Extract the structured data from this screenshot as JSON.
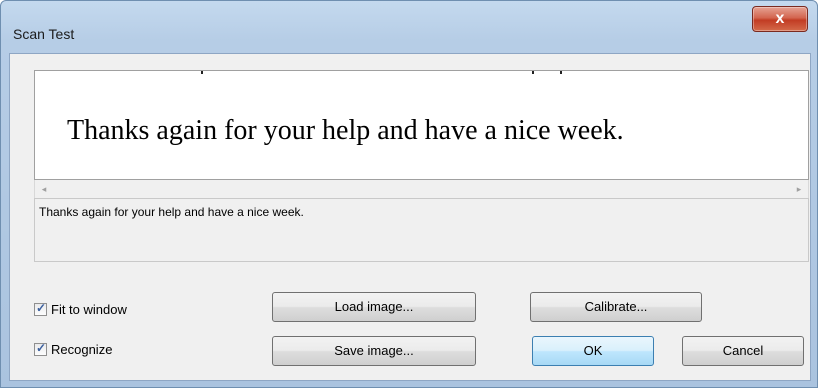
{
  "window": {
    "title": "Scan Test",
    "close_symbol": "x"
  },
  "image_area": {
    "scanned_text": "Thanks again for your help and have a nice week."
  },
  "scrollbar": {
    "left_arrow": "◂",
    "right_arrow": "▸"
  },
  "result": {
    "text": "Thanks again for your help and have a nice week."
  },
  "options": {
    "fit_to_window": {
      "label": "Fit to window",
      "checked": true
    },
    "recognize": {
      "label": "Recognize",
      "checked": true
    },
    "check_mark": "✓"
  },
  "buttons": {
    "load_image": "Load image...",
    "save_image": "Save image...",
    "calibrate": "Calibrate...",
    "ok": "OK",
    "cancel": "Cancel"
  },
  "colors": {
    "titlebar": "#b6cde6",
    "close_button": "#c23c24",
    "default_button_border": "#3c7fb1"
  }
}
